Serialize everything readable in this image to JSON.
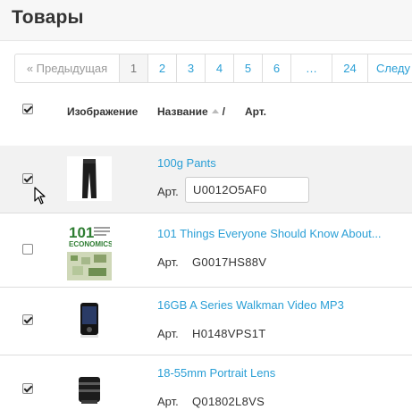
{
  "page": {
    "title": "Товары"
  },
  "pagination": {
    "prev": "« Предыдущая",
    "pages": [
      "1",
      "2",
      "3",
      "4",
      "5",
      "6",
      "…",
      "24"
    ],
    "next": "Следу",
    "current": "1"
  },
  "table": {
    "headers": {
      "image": "Изображение",
      "name": "Название",
      "separator": "/",
      "sku": "Арт."
    },
    "sort_icon": "sort-asc-icon"
  },
  "products": [
    {
      "name": "100g Pants",
      "sku_label": "Арт.",
      "sku": "U0012O5AF0",
      "checked": true,
      "editing": true
    },
    {
      "name": "101 Things Everyone Should Know About...",
      "sku_label": "Арт.",
      "sku": "G0017HS88V",
      "checked": false,
      "editing": false
    },
    {
      "name": "16GB A Series Walkman Video MP3",
      "sku_label": "Арт.",
      "sku": "H0148VPS1T",
      "checked": true,
      "editing": false
    },
    {
      "name": "18-55mm Portrait Lens",
      "sku_label": "Арт.",
      "sku": "Q01802L8VS",
      "checked": true,
      "editing": false
    }
  ],
  "thumbnails": {
    "book_title_big": "101",
    "book_title_small": "ECONOMICS"
  },
  "colors": {
    "link": "#2a9fd6",
    "hover_row": "#f2f2f2",
    "border": "#dddddd"
  },
  "icons": [
    "mouse-pointer-icon",
    "sort-asc-icon"
  ]
}
